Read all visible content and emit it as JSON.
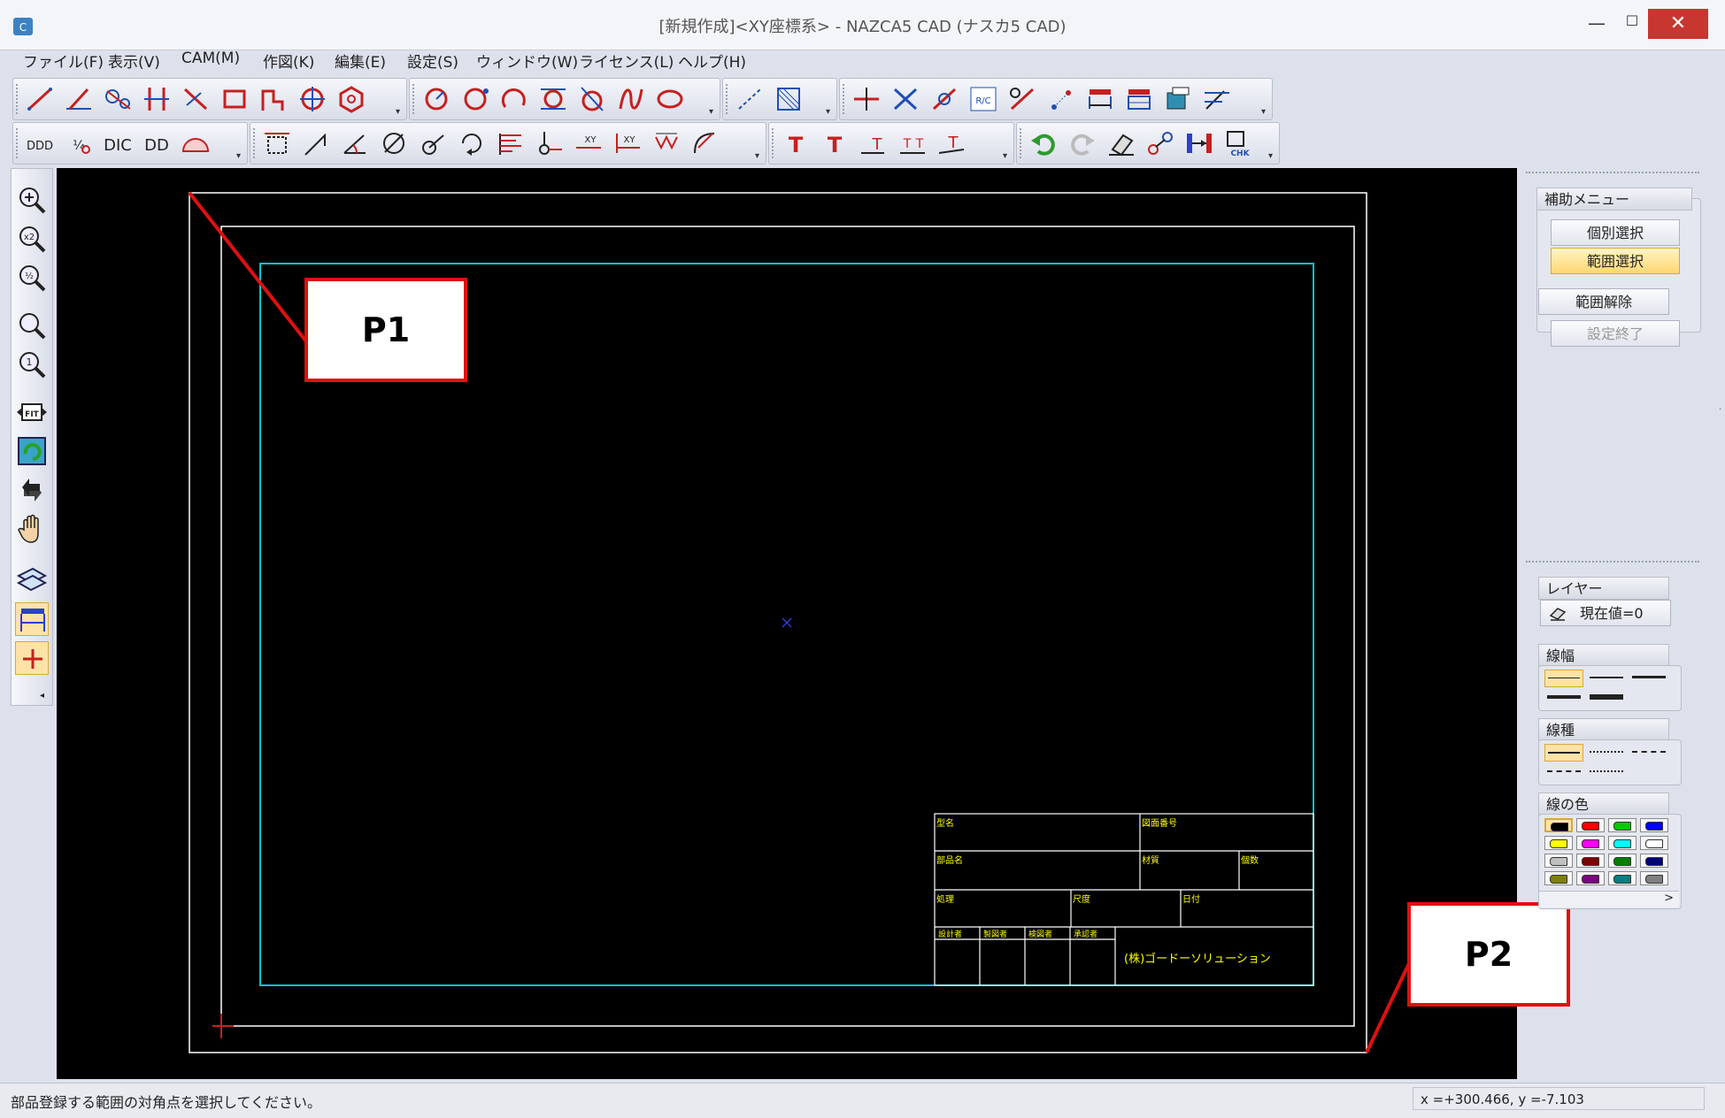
{
  "window": {
    "title": "[新規作成]<XY座標系> - NAZCA5 CAD (ナスカ5 CAD)",
    "minimize": "—",
    "maximize": "☐",
    "close": "✕"
  },
  "menu": [
    {
      "label": "ファイル(F)"
    },
    {
      "label": "表示(V)"
    },
    {
      "label": "CAM(M)"
    },
    {
      "label": "作図(K)"
    },
    {
      "label": "編集(E)"
    },
    {
      "label": "設定(S)"
    },
    {
      "label": "ウィンドウ(W)"
    },
    {
      "label": "ライセンス(L)"
    },
    {
      "label": "ヘルプ(H)"
    }
  ],
  "title_block": {
    "model": "型名",
    "drawing_no": "図面番号",
    "part_name": "部品名",
    "material": "材質",
    "quantity": "個数",
    "treatment": "処理",
    "scale": "尺度",
    "date": "日付",
    "designer": "設計者",
    "drafter": "製図者",
    "checker": "検図者",
    "approver": "承認者",
    "company": "(株)ゴードーソリューション"
  },
  "right_panel": {
    "aux_menu": {
      "title": "補助メニュー",
      "individual_select": "個別選択",
      "range_select": "範囲選択",
      "range_clear": "範囲解除",
      "end_setting": "設定終了"
    },
    "layer": {
      "title": "レイヤー",
      "current": "現在値=0"
    },
    "line_width": {
      "title": "線幅"
    },
    "line_type": {
      "title": "線種"
    },
    "line_color": {
      "title": "線の色",
      "colors": [
        "#000000",
        "#ff0000",
        "#00cc00",
        "#0000ff",
        "#ffff00",
        "#ff00ff",
        "#00ffff",
        "#ffffff",
        "#c0c0c0",
        "#800000",
        "#008000",
        "#000080",
        "#808000",
        "#800080",
        "#008080",
        "#808080"
      ],
      "scroll_right": ">"
    }
  },
  "status": {
    "message": "部品登録する範囲の対角点を選択してください。",
    "coords": "x =+300.466,    y =-7.103"
  },
  "callouts": {
    "p1": "P1",
    "p2": "P2"
  },
  "colors": {
    "canvas_bg": "#000000",
    "border_line": "#ffffff",
    "frame_line": "#00c8c8",
    "title_text": "#ffff00",
    "callout_red": "#e01010"
  }
}
